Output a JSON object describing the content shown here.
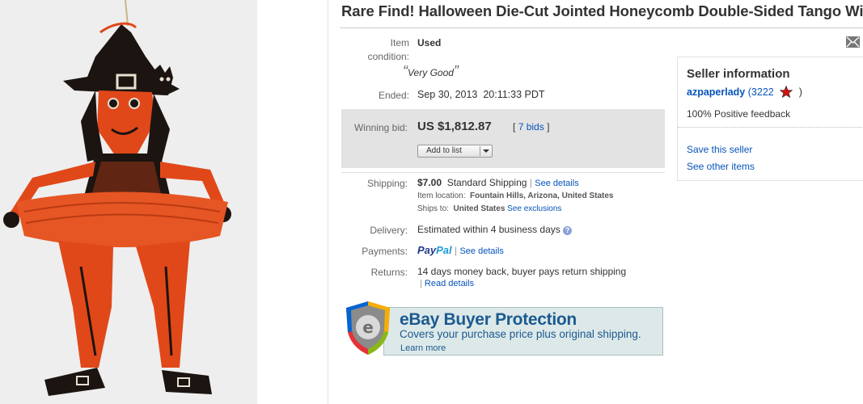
{
  "title": "Rare Find! Halloween Die-Cut Jointed Honeycomb Double-Sided Tango Witch",
  "condition": {
    "label_line1": "Item",
    "label_line2": "condition:",
    "value": "Used",
    "quote": "Very Good",
    "open_quote": "“",
    "close_quote": "”"
  },
  "ended": {
    "label": "Ended:",
    "value": "Sep 30, 2013  20:11:33 PDT"
  },
  "winning": {
    "label": "Winning bid:",
    "price": "US $1,812.87",
    "bids_open": "[",
    "bids_link": "7 bids",
    "bids_close": "]",
    "add_to_list": "Add to list"
  },
  "shipping": {
    "label": "Shipping:",
    "cost": "$7.00",
    "method": "Standard Shipping",
    "sep": "|",
    "see_details": "See details",
    "location_label": "Item location:",
    "location": "Fountain Hills, Arizona, United States",
    "ships_to_label": "Ships to:",
    "ships_to": "United States",
    "see_exclusions": "See exclusions"
  },
  "delivery": {
    "label": "Delivery:",
    "value": "Estimated within 4 business days",
    "help": "?"
  },
  "payments": {
    "label": "Payments:",
    "paypal_pay": "Pay",
    "paypal_pal": "Pal",
    "sep": "|",
    "see_details": "See details"
  },
  "returns": {
    "label": "Returns:",
    "value": "14 days money back, buyer pays return shipping",
    "sep": "|",
    "read_details": "Read details"
  },
  "seller": {
    "heading": "Seller information",
    "name": "azpaperlady",
    "score_open": "(",
    "score": "3222",
    "score_close": ")",
    "feedback": "100% Positive feedback",
    "save": "Save this seller",
    "other_items": "See other items"
  },
  "protection": {
    "title": "eBay Buyer Protection",
    "subtitle": "Covers your purchase price plus original shipping.",
    "learn_more": "Learn more",
    "logo_letter": "e"
  },
  "colors": {
    "link": "#0654ba",
    "paypal_dark": "#1e3a8a",
    "paypal_light": "#1b9bd8",
    "star": "#d01414",
    "witch_orange": "#e0481a",
    "witch_black": "#1c1410"
  },
  "icons": [
    "witch-photo",
    "mail-icon",
    "help-icon",
    "star-icon",
    "ebay-shield-logo",
    "dropdown-arrow-icon"
  ]
}
